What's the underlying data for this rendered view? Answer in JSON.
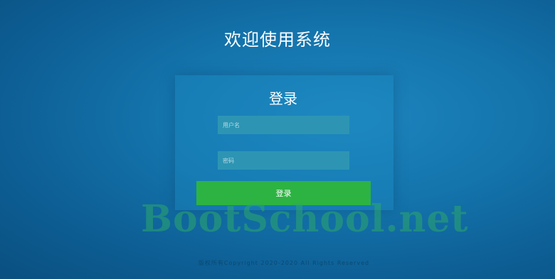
{
  "header": {
    "title": "欢迎使用系统"
  },
  "login": {
    "title": "登录",
    "username_placeholder": "用户名",
    "password_placeholder": "密码",
    "submit_label": "登录"
  },
  "watermark": {
    "text": "BootSchool.net"
  },
  "footer": {
    "copyright": "版权所有Copyright 2020-2020 All Rights Reserved"
  },
  "colors": {
    "background": "#1474ac",
    "field": "#2d95b3",
    "button": "#2db342"
  }
}
